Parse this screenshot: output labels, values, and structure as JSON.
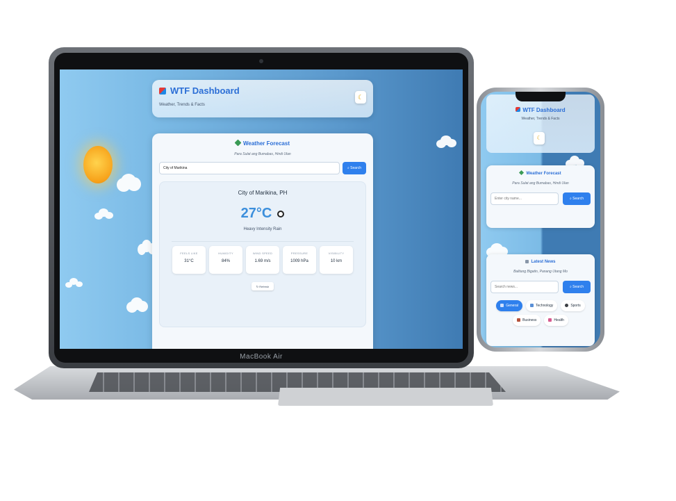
{
  "laptop": {
    "brand": "MacBook Air",
    "header": {
      "title": "WTF Dashboard",
      "subtitle": "Weather, Trends & Facts",
      "theme_icon": "moon-icon"
    },
    "weather": {
      "title": "Weather Forecast",
      "subtitle": "Para Sulat ang Bumabas, Hindi Ulan",
      "city_input_value": "City of Marikina",
      "search_label": "Search",
      "city": "City of Marikina, PH",
      "temperature": "27°C",
      "condition": "Heavy Intensity Rain",
      "stats": [
        {
          "label": "FEELS LIKE",
          "value": "31°C"
        },
        {
          "label": "HUMIDITY",
          "value": "84%"
        },
        {
          "label": "WIND SPEED",
          "value": "1.69 m/s"
        },
        {
          "label": "PRESSURE",
          "value": "1009 hPa"
        },
        {
          "label": "VISIBILITY",
          "value": "10 km"
        }
      ],
      "refresh_label": "Refresh"
    }
  },
  "phone": {
    "header": {
      "title": "WTF Dashboard",
      "subtitle": "Weather, Trends & Facts"
    },
    "weather": {
      "title": "Weather Forecast",
      "subtitle": "Para Sulat ang Bumabas, Hindi Ulan",
      "input_placeholder": "Enter city name...",
      "search_label": "Search"
    },
    "news": {
      "title": "Latest News",
      "subtitle": "Balitang Bigatin, Panang Utang Mo",
      "input_placeholder": "Search news...",
      "search_label": "Search",
      "categories": [
        "General",
        "Technology",
        "Sports",
        "Business",
        "Health"
      ],
      "active_category": "General"
    }
  },
  "colors": {
    "accent": "#2f80ed",
    "title_blue": "#2b6ed6",
    "sky_light": "#8fcaf0",
    "sky_dark": "#3f7bb3"
  }
}
